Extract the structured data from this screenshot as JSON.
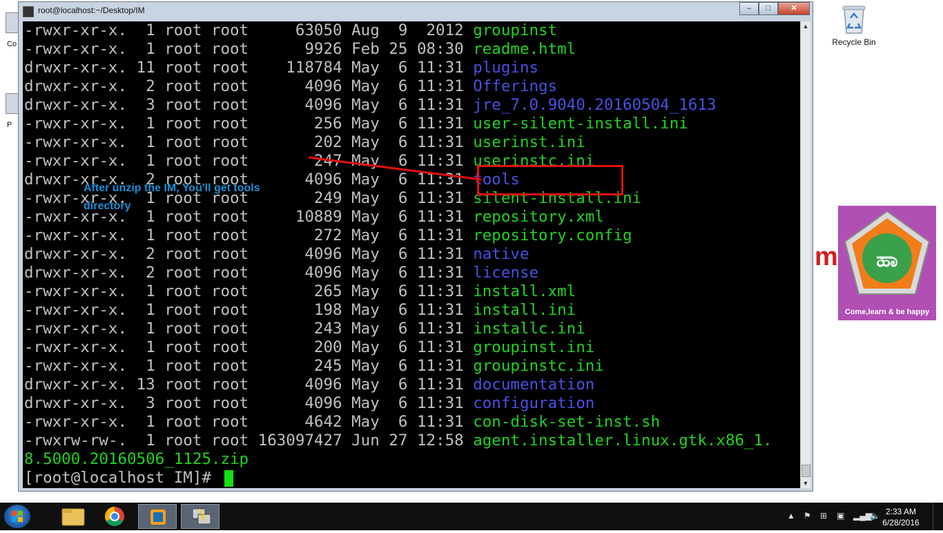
{
  "window": {
    "title": "root@localhost:~/Desktop/IM",
    "minimize": "–",
    "maximize": "□",
    "close": "✕"
  },
  "terminal": {
    "lines": [
      {
        "meta": "-rwxr-xr-x.  1 root root     63050 Aug  9  2012 ",
        "name": "groupinst",
        "kind": "file"
      },
      {
        "meta": "-rwxr-xr-x.  1 root root      9926 Feb 25 08:30 ",
        "name": "readme.html",
        "kind": "file"
      },
      {
        "meta": "drwxr-xr-x. 11 root root    118784 May  6 11:31 ",
        "name": "plugins",
        "kind": "dir"
      },
      {
        "meta": "drwxr-xr-x.  2 root root      4096 May  6 11:31 ",
        "name": "Offerings",
        "kind": "dir"
      },
      {
        "meta": "drwxr-xr-x.  3 root root      4096 May  6 11:31 ",
        "name": "jre_7.0.9040.20160504_1613",
        "kind": "dir"
      },
      {
        "meta": "-rwxr-xr-x.  1 root root       256 May  6 11:31 ",
        "name": "user-silent-install.ini",
        "kind": "file"
      },
      {
        "meta": "-rwxr-xr-x.  1 root root       202 May  6 11:31 ",
        "name": "userinst.ini",
        "kind": "file"
      },
      {
        "meta": "-rwxr-xr-x.  1 root root       247 May  6 11:31 ",
        "name": "userinstc.ini",
        "kind": "file"
      },
      {
        "meta": "drwxr-xr-x.  2 root root      4096 May  6 11:31 ",
        "name": "tools",
        "kind": "dir"
      },
      {
        "meta": "-rwxr-xr-x.  1 root root       249 May  6 11:31 ",
        "name": "silent-install.ini",
        "kind": "file"
      },
      {
        "meta": "-rwxr-xr-x.  1 root root     10889 May  6 11:31 ",
        "name": "repository.xml",
        "kind": "file"
      },
      {
        "meta": "-rwxr-xr-x.  1 root root       272 May  6 11:31 ",
        "name": "repository.config",
        "kind": "file"
      },
      {
        "meta": "drwxr-xr-x.  2 root root      4096 May  6 11:31 ",
        "name": "native",
        "kind": "dir"
      },
      {
        "meta": "drwxr-xr-x.  2 root root      4096 May  6 11:31 ",
        "name": "license",
        "kind": "dir"
      },
      {
        "meta": "-rwxr-xr-x.  1 root root       265 May  6 11:31 ",
        "name": "install.xml",
        "kind": "file"
      },
      {
        "meta": "-rwxr-xr-x.  1 root root       198 May  6 11:31 ",
        "name": "install.ini",
        "kind": "file"
      },
      {
        "meta": "-rwxr-xr-x.  1 root root       243 May  6 11:31 ",
        "name": "installc.ini",
        "kind": "file"
      },
      {
        "meta": "-rwxr-xr-x.  1 root root       200 May  6 11:31 ",
        "name": "groupinst.ini",
        "kind": "file"
      },
      {
        "meta": "-rwxr-xr-x.  1 root root       245 May  6 11:31 ",
        "name": "groupinstc.ini",
        "kind": "file"
      },
      {
        "meta": "drwxr-xr-x. 13 root root      4096 May  6 11:31 ",
        "name": "documentation",
        "kind": "dir"
      },
      {
        "meta": "drwxr-xr-x.  3 root root      4096 May  6 11:31 ",
        "name": "configuration",
        "kind": "dir"
      },
      {
        "meta": "-rwxr-xr-x.  1 root root      4642 May  6 11:31 ",
        "name": "con-disk-set-inst.sh",
        "kind": "file"
      },
      {
        "meta": "-rwxrw-rw-.  1 root root 163097427 Jun 27 12:58 ",
        "name": "agent.installer.linux.gtk.x86_1.",
        "kind": "file"
      },
      {
        "meta": "",
        "name": "8.5000.20160506_1125.zip",
        "kind": "file"
      }
    ],
    "prompt": "[root@localhost IM]# "
  },
  "annotation": {
    "text_line1": "After unzip the IM, You'll get tools",
    "text_line2": "directory",
    "color": "#e01010"
  },
  "desktop": {
    "recycle_bin_label": "Recycle Bin",
    "left_icon1_label": "Co",
    "left_icon2_label": "P",
    "logo_label": "Come,learn & be happy",
    "logo_letters": "ಹಾ"
  },
  "taskbar": {
    "time": "2:33 AM",
    "date": "6/28/2016"
  },
  "colors": {
    "file_green": "#22d022",
    "dir_blue": "#4a50e0",
    "cursor_green": "#14e014"
  }
}
